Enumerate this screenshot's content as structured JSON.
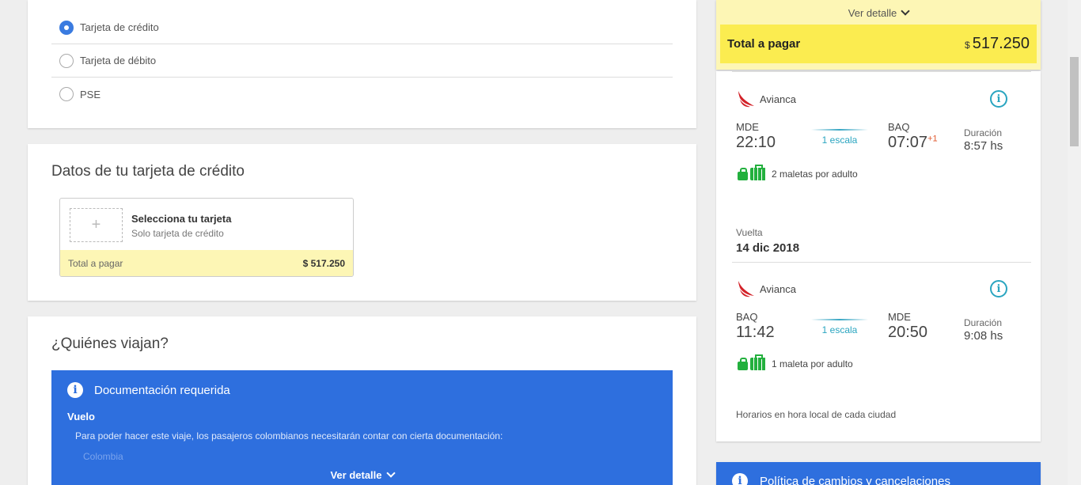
{
  "payment_methods": {
    "items": [
      {
        "label": "Tarjeta de crédito",
        "selected": true
      },
      {
        "label": "Tarjeta de débito",
        "selected": false
      },
      {
        "label": "PSE",
        "selected": false
      }
    ]
  },
  "card_data": {
    "title": "Datos de tu tarjeta de crédito",
    "plus": "+",
    "select_title": "Selecciona tu tarjeta",
    "select_sub": "Solo tarjeta de crédito",
    "total_label": "Total a pagar",
    "total_amount": "$ 517.250"
  },
  "travellers": {
    "title": "¿Quiénes viajan?",
    "doc_title": "Documentación requerida",
    "doc_section": "Vuelo",
    "doc_text": "Para poder hacer este viaje, los pasajeros colombianos necesitarán contar con cierta documentación:",
    "doc_faded": "Colombia",
    "doc_more": "Ver detalle"
  },
  "summary": {
    "detail_label": "Ver detalle",
    "total_label": "Total a pagar",
    "currency": "$",
    "total_amount": "517.250"
  },
  "itinerary": {
    "outbound": {
      "airline": "Avianca",
      "from_code": "MDE",
      "from_time": "22:10",
      "stops": "1 escala",
      "to_code": "BAQ",
      "to_time": "07:07",
      "day_offset": "+1",
      "duration_label": "Duración",
      "duration": "8:57 hs",
      "bags": "2 maletas por adulto"
    },
    "return_label": "Vuelta",
    "return_date": "14 dic 2018",
    "inbound": {
      "airline": "Avianca",
      "from_code": "BAQ",
      "from_time": "11:42",
      "stops": "1 escala",
      "to_code": "MDE",
      "to_time": "20:50",
      "duration_label": "Duración",
      "duration": "9:08 hs",
      "bags": "1 maleta por adulto"
    },
    "tz_note": "Horarios en hora local de cada ciudad"
  },
  "policy": {
    "title": "Política de cambios y cancelaciones"
  },
  "colors": {
    "accent_blue": "#2e6fde",
    "total_yellow": "#fbec50",
    "teal": "#2aa5c0",
    "bag_green": "#23b03e"
  }
}
